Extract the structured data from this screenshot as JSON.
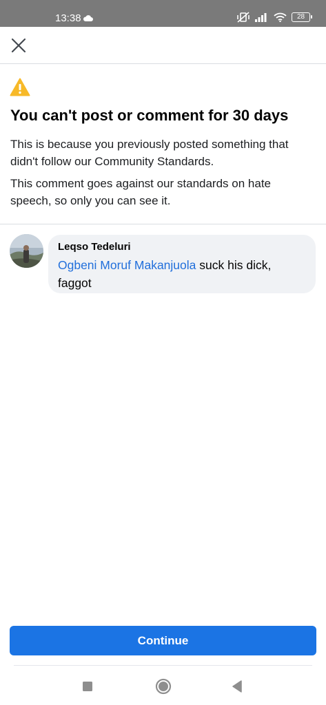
{
  "status_bar": {
    "time": "13:38",
    "battery": "28"
  },
  "dialog": {
    "title": "You can't post or comment for 30 days",
    "paragraph_1": "This is because you previously posted something that didn't follow our Community Standards.",
    "paragraph_2": "This comment goes against our standards on hate speech, so only you can see it."
  },
  "comment": {
    "author": "Leqso Tedeluri",
    "mention": "Ogbeni Moruf Makanjuola",
    "text": " suck his dick, faggot"
  },
  "continue_label": "Continue",
  "colors": {
    "accent": "#1b74e4",
    "mention": "#216fdb",
    "warning": "#f7b928"
  }
}
